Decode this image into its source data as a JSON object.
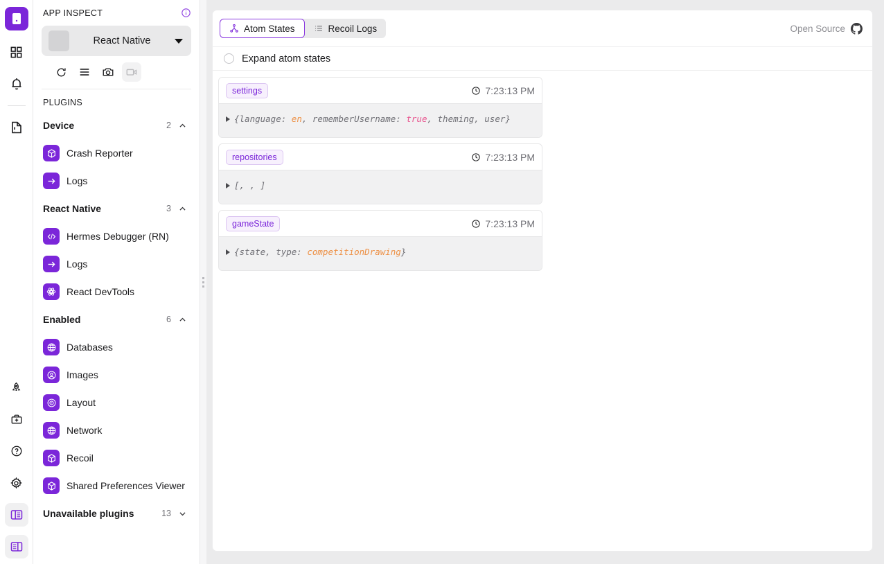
{
  "rail": {
    "items": [
      {
        "name": "app-logo-icon",
        "label": "Flipper"
      },
      {
        "name": "apps-grid-icon",
        "label": "Apps"
      },
      {
        "name": "notifications-bell-icon",
        "label": "Notifications"
      },
      {
        "name": "changelog-document-icon",
        "label": "Changelog"
      },
      {
        "name": "rocket-icon",
        "label": "Launch"
      },
      {
        "name": "toolbox-icon",
        "label": "Doctor"
      },
      {
        "name": "help-circle-icon",
        "label": "Help"
      },
      {
        "name": "settings-gear-icon",
        "label": "Settings"
      },
      {
        "name": "toggle-left-sidebar-icon",
        "label": "Toggle left sidebar"
      },
      {
        "name": "toggle-right-sidebar-icon",
        "label": "Toggle right sidebar"
      }
    ]
  },
  "sidebar": {
    "title": "APP INSPECT",
    "app_selector": {
      "value": "React Native"
    },
    "tools": [
      {
        "name": "reload-icon",
        "label": "Reload"
      },
      {
        "name": "menu-icon",
        "label": "More"
      },
      {
        "name": "camera-icon",
        "label": "Screenshot"
      },
      {
        "name": "video-record-icon",
        "label": "Record"
      }
    ],
    "plugins_label": "PLUGINS",
    "groups": [
      {
        "name": "Device",
        "count": "2",
        "expanded": true,
        "items": [
          {
            "label": "Crash Reporter",
            "icon": "cube-icon"
          },
          {
            "label": "Logs",
            "icon": "arrow-right-icon"
          }
        ]
      },
      {
        "name": "React Native",
        "count": "3",
        "expanded": true,
        "items": [
          {
            "label": "Hermes Debugger (RN)",
            "icon": "code-brackets-icon"
          },
          {
            "label": "Logs",
            "icon": "arrow-right-icon"
          },
          {
            "label": "React DevTools",
            "icon": "atom-icon"
          }
        ]
      },
      {
        "name": "Enabled",
        "count": "6",
        "expanded": true,
        "items": [
          {
            "label": "Databases",
            "icon": "globe-icon"
          },
          {
            "label": "Images",
            "icon": "person-circle-icon"
          },
          {
            "label": "Layout",
            "icon": "target-icon"
          },
          {
            "label": "Network",
            "icon": "globe-icon"
          },
          {
            "label": "Recoil",
            "icon": "cube-icon"
          },
          {
            "label": "Shared Preferences Viewer",
            "icon": "cube-icon"
          }
        ]
      },
      {
        "name": "Unavailable plugins",
        "count": "13",
        "expanded": false,
        "items": []
      }
    ]
  },
  "main": {
    "tabs": [
      {
        "label": "Atom States",
        "icon": "hierarchy-icon",
        "active": true
      },
      {
        "label": "Recoil Logs",
        "icon": "list-icon",
        "active": false
      }
    ],
    "open_source": {
      "label": "Open Source",
      "icon": "github-icon"
    },
    "expand_toggle": {
      "label": "Expand atom states",
      "checked": false
    },
    "cards": [
      {
        "atom": "settings",
        "time": "7:23:13 PM",
        "parts": [
          {
            "text": "{language: ",
            "kind": "plain"
          },
          {
            "text": "en",
            "kind": "string"
          },
          {
            "text": ", rememberUsername: ",
            "kind": "plain"
          },
          {
            "text": "true",
            "kind": "bool"
          },
          {
            "text": ", theming, user}",
            "kind": "plain"
          }
        ]
      },
      {
        "atom": "repositories",
        "time": "7:23:13 PM",
        "parts": [
          {
            "text": "[, , ]",
            "kind": "plain"
          }
        ]
      },
      {
        "atom": "gameState",
        "time": "7:23:13 PM",
        "parts": [
          {
            "text": "{state, type: ",
            "kind": "plain"
          },
          {
            "text": "competitionDrawing",
            "kind": "string"
          },
          {
            "text": "}",
            "kind": "plain"
          }
        ]
      }
    ]
  },
  "colors": {
    "accent": "#7b26d9",
    "chip_text": "#7b26d9",
    "string_value": "#ed9045",
    "bool_value": "#e8558f",
    "page_bg": "#ebebec"
  }
}
